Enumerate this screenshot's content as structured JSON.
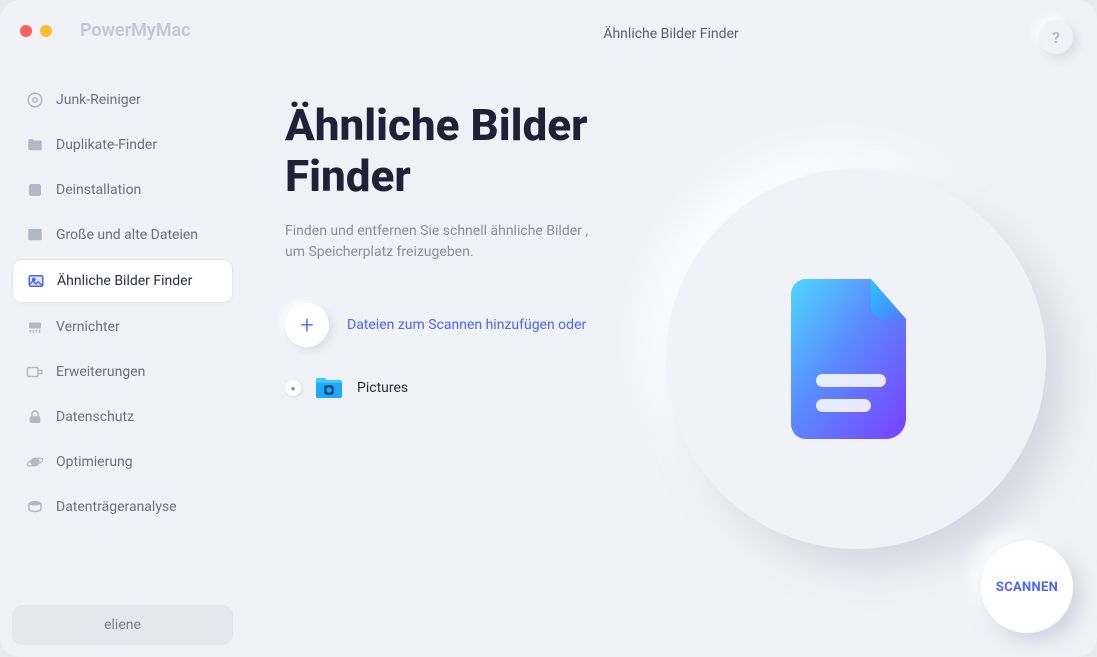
{
  "app_name": "PowerMyMac",
  "window_title": "Ähnliche Bilder Finder",
  "help_label": "?",
  "sidebar": {
    "items": [
      {
        "label": "Junk-Reiniger",
        "icon": "target"
      },
      {
        "label": "Duplikate-Finder",
        "icon": "folder"
      },
      {
        "label": "Deinstallation",
        "icon": "app"
      },
      {
        "label": "Große und alte Dateien",
        "icon": "box"
      },
      {
        "label": "Ähnliche Bilder Finder",
        "icon": "image",
        "active": true
      },
      {
        "label": "Vernichter",
        "icon": "shredder"
      },
      {
        "label": "Erweiterungen",
        "icon": "extension"
      },
      {
        "label": "Datenschutz",
        "icon": "lock"
      },
      {
        "label": "Optimierung",
        "icon": "planet"
      },
      {
        "label": "Datenträgeranalyse",
        "icon": "disk"
      }
    ],
    "footer_user": "eliene"
  },
  "main": {
    "heading": "Ähnliche Bilder Finder",
    "subtext": "Finden und entfernen Sie schnell ähnliche Bilder , um Speicherplatz freizugeben.",
    "add_label": "Dateien zum Scannen hinzufügen oder",
    "folders": [
      {
        "name": "Pictures"
      }
    ],
    "scan_label": "SCANNEN"
  }
}
